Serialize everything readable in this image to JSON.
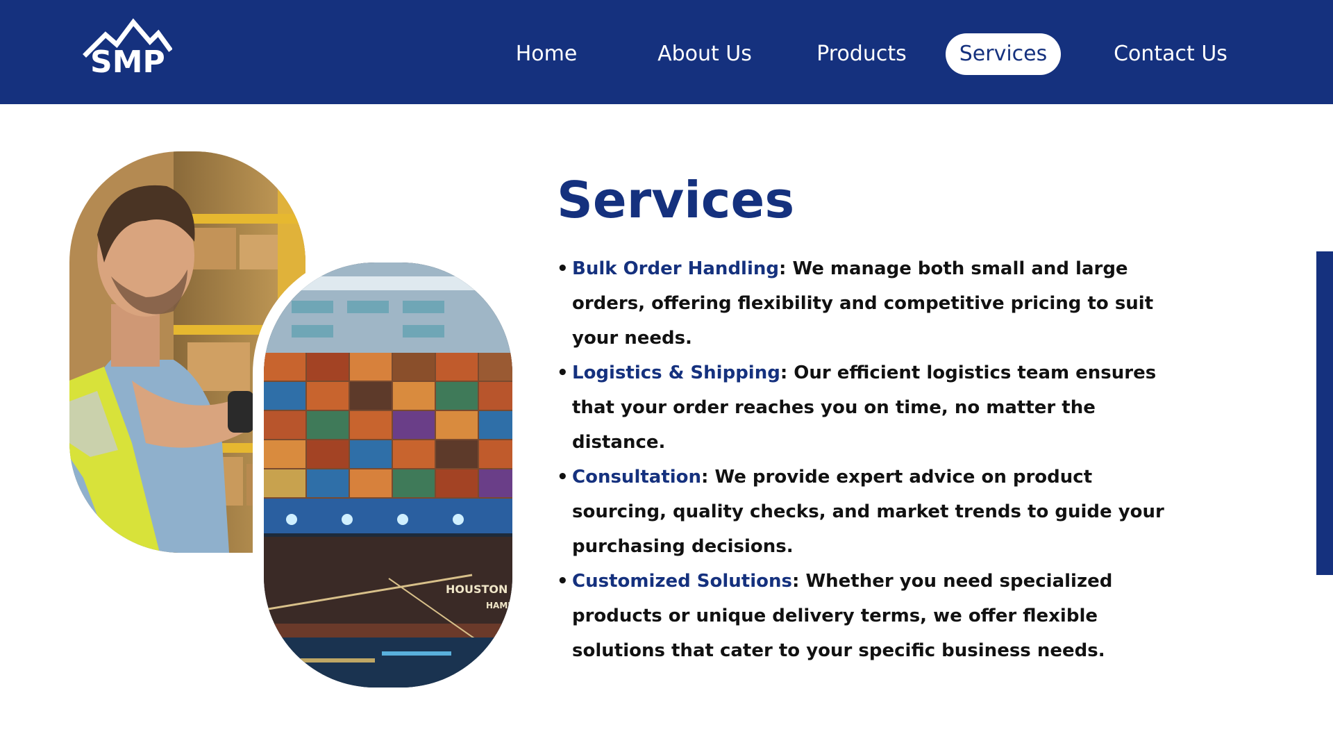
{
  "brand": {
    "logo_text": "SMP"
  },
  "nav": {
    "items": [
      {
        "label": "Home"
      },
      {
        "label": "About Us"
      },
      {
        "label": "Products"
      },
      {
        "label": "Services"
      },
      {
        "label": "Contact Us"
      }
    ],
    "active": "Services"
  },
  "main": {
    "title": "Services",
    "images": {
      "worker_alt": "Warehouse worker scanning boxes",
      "ship_label": "HOUSTON",
      "ship_label_2": "HAMB"
    },
    "services": [
      {
        "bullet": "•",
        "term": "Bulk Order Handling",
        "description": ": We manage both small and large orders, offering flexibility and competitive pricing to suit your needs."
      },
      {
        "bullet": "•",
        "term": "Logistics & Shipping",
        "description": ": Our efficient logistics team ensures that your order reaches you on time, no matter the distance."
      },
      {
        "bullet": "•",
        "term": "Consultation",
        "description": ": We provide expert advice on product sourcing, quality checks, and market trends to guide your purchasing decisions."
      },
      {
        "bullet": "•",
        "term": "Customized Solutions",
        "description": ": Whether you need specialized products or unique delivery terms, we offer flexible solutions that cater to your specific business needs."
      }
    ]
  },
  "colors": {
    "brand_navy": "#15317e",
    "background": "#ffffff",
    "body_text": "#111111"
  }
}
